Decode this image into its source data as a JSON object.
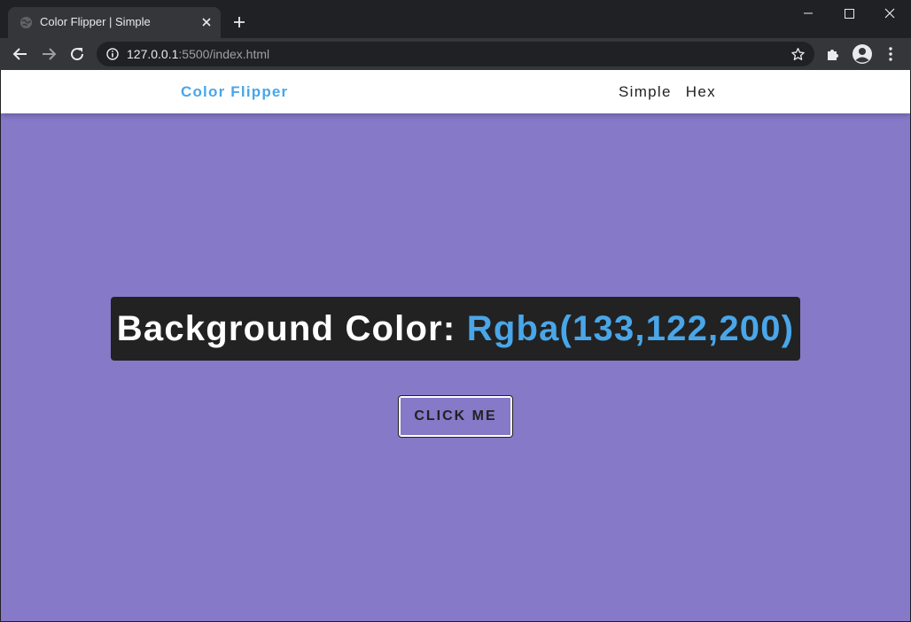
{
  "browser": {
    "tab_title": "Color Flipper | Simple",
    "url_host": "127.0.0.1",
    "url_rest": ":5500/index.html"
  },
  "icons": {
    "favicon": "globe-icon",
    "tab_close": "close-icon",
    "new_tab": "plus-icon",
    "minimize": "minimize-icon",
    "maximize": "maximize-icon",
    "window_close": "close-icon",
    "back": "back-arrow-icon",
    "forward": "forward-arrow-icon",
    "reload": "reload-icon",
    "site_info": "info-icon",
    "bookmark": "star-icon",
    "extensions": "puzzle-icon",
    "profile": "account-icon",
    "menu": "kebab-menu-icon"
  },
  "navbar": {
    "brand": "Color Flipper",
    "links": [
      "Simple",
      "Hex"
    ]
  },
  "main": {
    "heading_label": "Background Color: ",
    "color_value": "Rgba(133,122,200)",
    "button_label": "CLICK ME"
  },
  "colors": {
    "page_background": "#8579c8",
    "accent": "#49a6e9",
    "heading_background": "#222222"
  }
}
